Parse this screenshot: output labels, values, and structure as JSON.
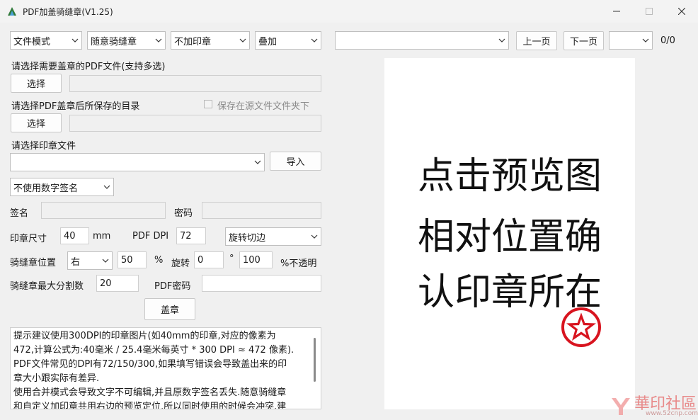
{
  "window": {
    "title": "PDF加盖骑缝章(V1.25)",
    "minimize": "—",
    "maximize": "☐",
    "close": "✕"
  },
  "toolbar": {
    "mode": "文件模式",
    "seal_type": "随意骑缝章",
    "stamp_option": "不加印章",
    "overlay": "叠加",
    "file_select": "",
    "prev_page": "上一页",
    "next_page": "下一页",
    "page_select": "",
    "page_counter": "0/0"
  },
  "form": {
    "pdf_files_label": "请选择需要盖章的PDF文件(支持多选)",
    "choose_button": "选择",
    "save_dir_label": "请选择PDF盖章后所保存的目录",
    "save_in_source_label": "保存在源文件文件夹下",
    "stamp_file_label": "请选择印章文件",
    "stamp_file_select": "",
    "import_button": "导入",
    "digital_sign_select": "不使用数字签名",
    "sign_label": "签名",
    "password_label": "密码",
    "stamp_size_label": "印章尺寸",
    "stamp_size_value": "40",
    "stamp_size_unit": "mm",
    "pdf_dpi_label": "PDF DPI",
    "pdf_dpi_value": "72",
    "rotate_crop_select": "旋转切边",
    "seam_position_label": "骑缝章位置",
    "seam_position_select": "右",
    "seam_percent_value": "50",
    "percent_sign": "%",
    "rotate_label": "旋转",
    "rotate_value": "0",
    "degree_sign": "°",
    "opacity_value": "100",
    "opacity_label": "%不透明",
    "max_split_label": "骑缝章最大分割数",
    "max_split_value": "20",
    "pdf_password_label": "PDF密码",
    "stamp_button": "盖章"
  },
  "log": {
    "lines": [
      "提示建议使用300DPI的印章图片(如40mm的印章,对应的像素为",
      "472,计算公式为:40毫米 / 25.4毫米每英寸 * 300 DPI ≈ 472 像素).",
      "PDF文件常见的DPI有72/150/300,如果填写错误会导致盖出来的印",
      "章大小跟实际有差异.",
      "使用合并模式会导致文字不可编辑,并且原数字签名丢失.随意骑缝章",
      "和自定义加印章共用右边的预览定位,所以同时使用的时候会冲突,建"
    ]
  },
  "preview": {
    "line1": "点击预览图",
    "line2": "相对位置确",
    "line3": "认印章所在"
  },
  "watermark": {
    "text": "華印社區",
    "url": "www.52cnp.com"
  },
  "colors": {
    "stamp_red": "#d8141f",
    "window_bg": "#f0f0f0"
  }
}
